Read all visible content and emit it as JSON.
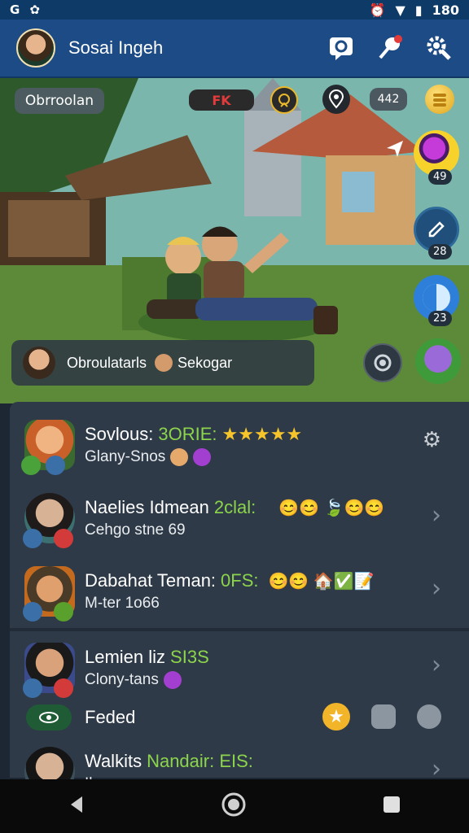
{
  "status_bar": {
    "left_icons": [
      "G",
      "✿"
    ],
    "right_icons": [
      "⏰",
      "▼",
      "▮"
    ],
    "time": "180"
  },
  "app": {
    "title": "Sosai Ingeh"
  },
  "scene": {
    "tag_left": "Obrroolan",
    "tag_center": "FK",
    "counter": "442",
    "badge_1": "49",
    "badge_2": "28",
    "badge_3": "23",
    "chat_preview": {
      "name_1": "Obroulatarls",
      "name_2": "Sekogar"
    }
  },
  "list": [
    {
      "name": "Sovlous:",
      "tag": "3ORIE:",
      "stars": "★★★★★",
      "sub": "Glany-Snos"
    },
    {
      "name": "Naelies Idmean",
      "tag": "2clal:",
      "emojis": "😊😊 🍃😊😊",
      "sub": "Cehgo stne 69"
    },
    {
      "name": "Dabahat Teman:",
      "tag": "0FS:",
      "emojis": "😊😊 🏠✅📝",
      "sub": "M-ter 1o66"
    },
    {
      "name": "Lemien liz",
      "tag": "SI3S",
      "sub": "Clony-tans"
    },
    {
      "name": "Feded"
    },
    {
      "name": "Walkits",
      "tag": "Nandair: EIS:",
      "sub": "Ilopvesaas"
    }
  ]
}
